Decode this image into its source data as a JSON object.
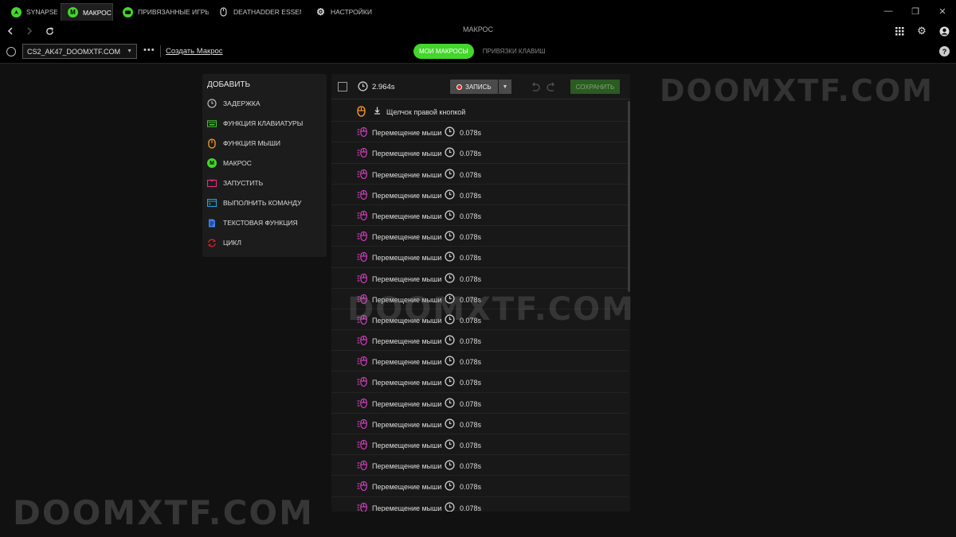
{
  "tabs": [
    {
      "label": "SYNAPSE",
      "icon": "razer-snake-icon",
      "active": false
    },
    {
      "label": "МАКРОС",
      "icon": "macro-m-icon",
      "active": true
    },
    {
      "label": "ПРИВЯЗАННЫЕ ИГРЫ",
      "icon": "gamepad-icon",
      "active": false
    },
    {
      "label": "DEATHADDER ESSENTIAL",
      "icon": "mouse-icon",
      "active": false
    },
    {
      "label": "НАСТРОЙКИ",
      "icon": "gear-icon",
      "active": false
    }
  ],
  "window_controls": {
    "minimize": "—",
    "restore": "❐",
    "close": "✕"
  },
  "nav": {
    "title": "МАКРОС"
  },
  "profile": {
    "selected": "CS2_AK47_DOOMXTF.COM",
    "create_link": "Создать Макрос"
  },
  "view_toggle": {
    "active": "МОИ МАКРОСЫ",
    "inactive": "ПРИВЯЗКИ КЛАВИШ"
  },
  "add_panel": {
    "title": "ДОБАВИТЬ",
    "items": [
      {
        "label": "ЗАДЕРЖКА",
        "icon": "clock-icon",
        "color": "#bbbbbb"
      },
      {
        "label": "ФУНКЦИЯ КЛАВИАТУРЫ",
        "icon": "keyboard-icon",
        "color": "#44d62c"
      },
      {
        "label": "ФУНКЦИЯ МЫШИ",
        "icon": "mouse-icon",
        "color": "#ff9d1c"
      },
      {
        "label": "МАКРОС",
        "icon": "macro-m-icon",
        "color": "#44d62c"
      },
      {
        "label": "ЗАПУСТИТЬ",
        "icon": "launch-icon",
        "color": "#e8307f"
      },
      {
        "label": "ВЫПОЛНИТЬ КОМАНДУ",
        "icon": "terminal-icon",
        "color": "#1fa6e0"
      },
      {
        "label": "ТЕКСТОВАЯ ФУНКЦИЯ",
        "icon": "text-icon",
        "color": "#3b82f6"
      },
      {
        "label": "ЦИКЛ",
        "icon": "loop-icon",
        "color": "#e0242a"
      }
    ]
  },
  "macro": {
    "total_duration": "2.964s",
    "record_label": "ЗАПИСЬ",
    "save_label": "СОХРАНИТЬ",
    "first_event": {
      "label": "Щелчок правой кнопкой",
      "icon": "mouse-icon"
    },
    "events": [
      {
        "label": "Перемещение мыши",
        "duration": "0.078s"
      },
      {
        "label": "Перемещение мыши",
        "duration": "0.078s"
      },
      {
        "label": "Перемещение мыши",
        "duration": "0.078s"
      },
      {
        "label": "Перемещение мыши",
        "duration": "0.078s"
      },
      {
        "label": "Перемещение мыши",
        "duration": "0.078s"
      },
      {
        "label": "Перемещение мыши",
        "duration": "0.078s"
      },
      {
        "label": "Перемещение мыши",
        "duration": "0.078s"
      },
      {
        "label": "Перемещение мыши",
        "duration": "0.078s"
      },
      {
        "label": "Перемещение мыши",
        "duration": "0.078s"
      },
      {
        "label": "Перемещение мыши",
        "duration": "0.078s"
      },
      {
        "label": "Перемещение мыши",
        "duration": "0.078s"
      },
      {
        "label": "Перемещение мыши",
        "duration": "0.078s"
      },
      {
        "label": "Перемещение мыши",
        "duration": "0.078s"
      },
      {
        "label": "Перемещение мыши",
        "duration": "0.078s"
      },
      {
        "label": "Перемещение мыши",
        "duration": "0.078s"
      },
      {
        "label": "Перемещение мыши",
        "duration": "0.078s"
      },
      {
        "label": "Перемещение мыши",
        "duration": "0.078s"
      },
      {
        "label": "Перемещение мыши",
        "duration": "0.078s"
      },
      {
        "label": "Перемещение мыши",
        "duration": "0.078s"
      }
    ]
  },
  "watermark": "DOOMXTF.COM",
  "colors": {
    "accent": "#44d62c",
    "mouse_move": "#e040c8",
    "mouse_click": "#ff9d1c"
  }
}
